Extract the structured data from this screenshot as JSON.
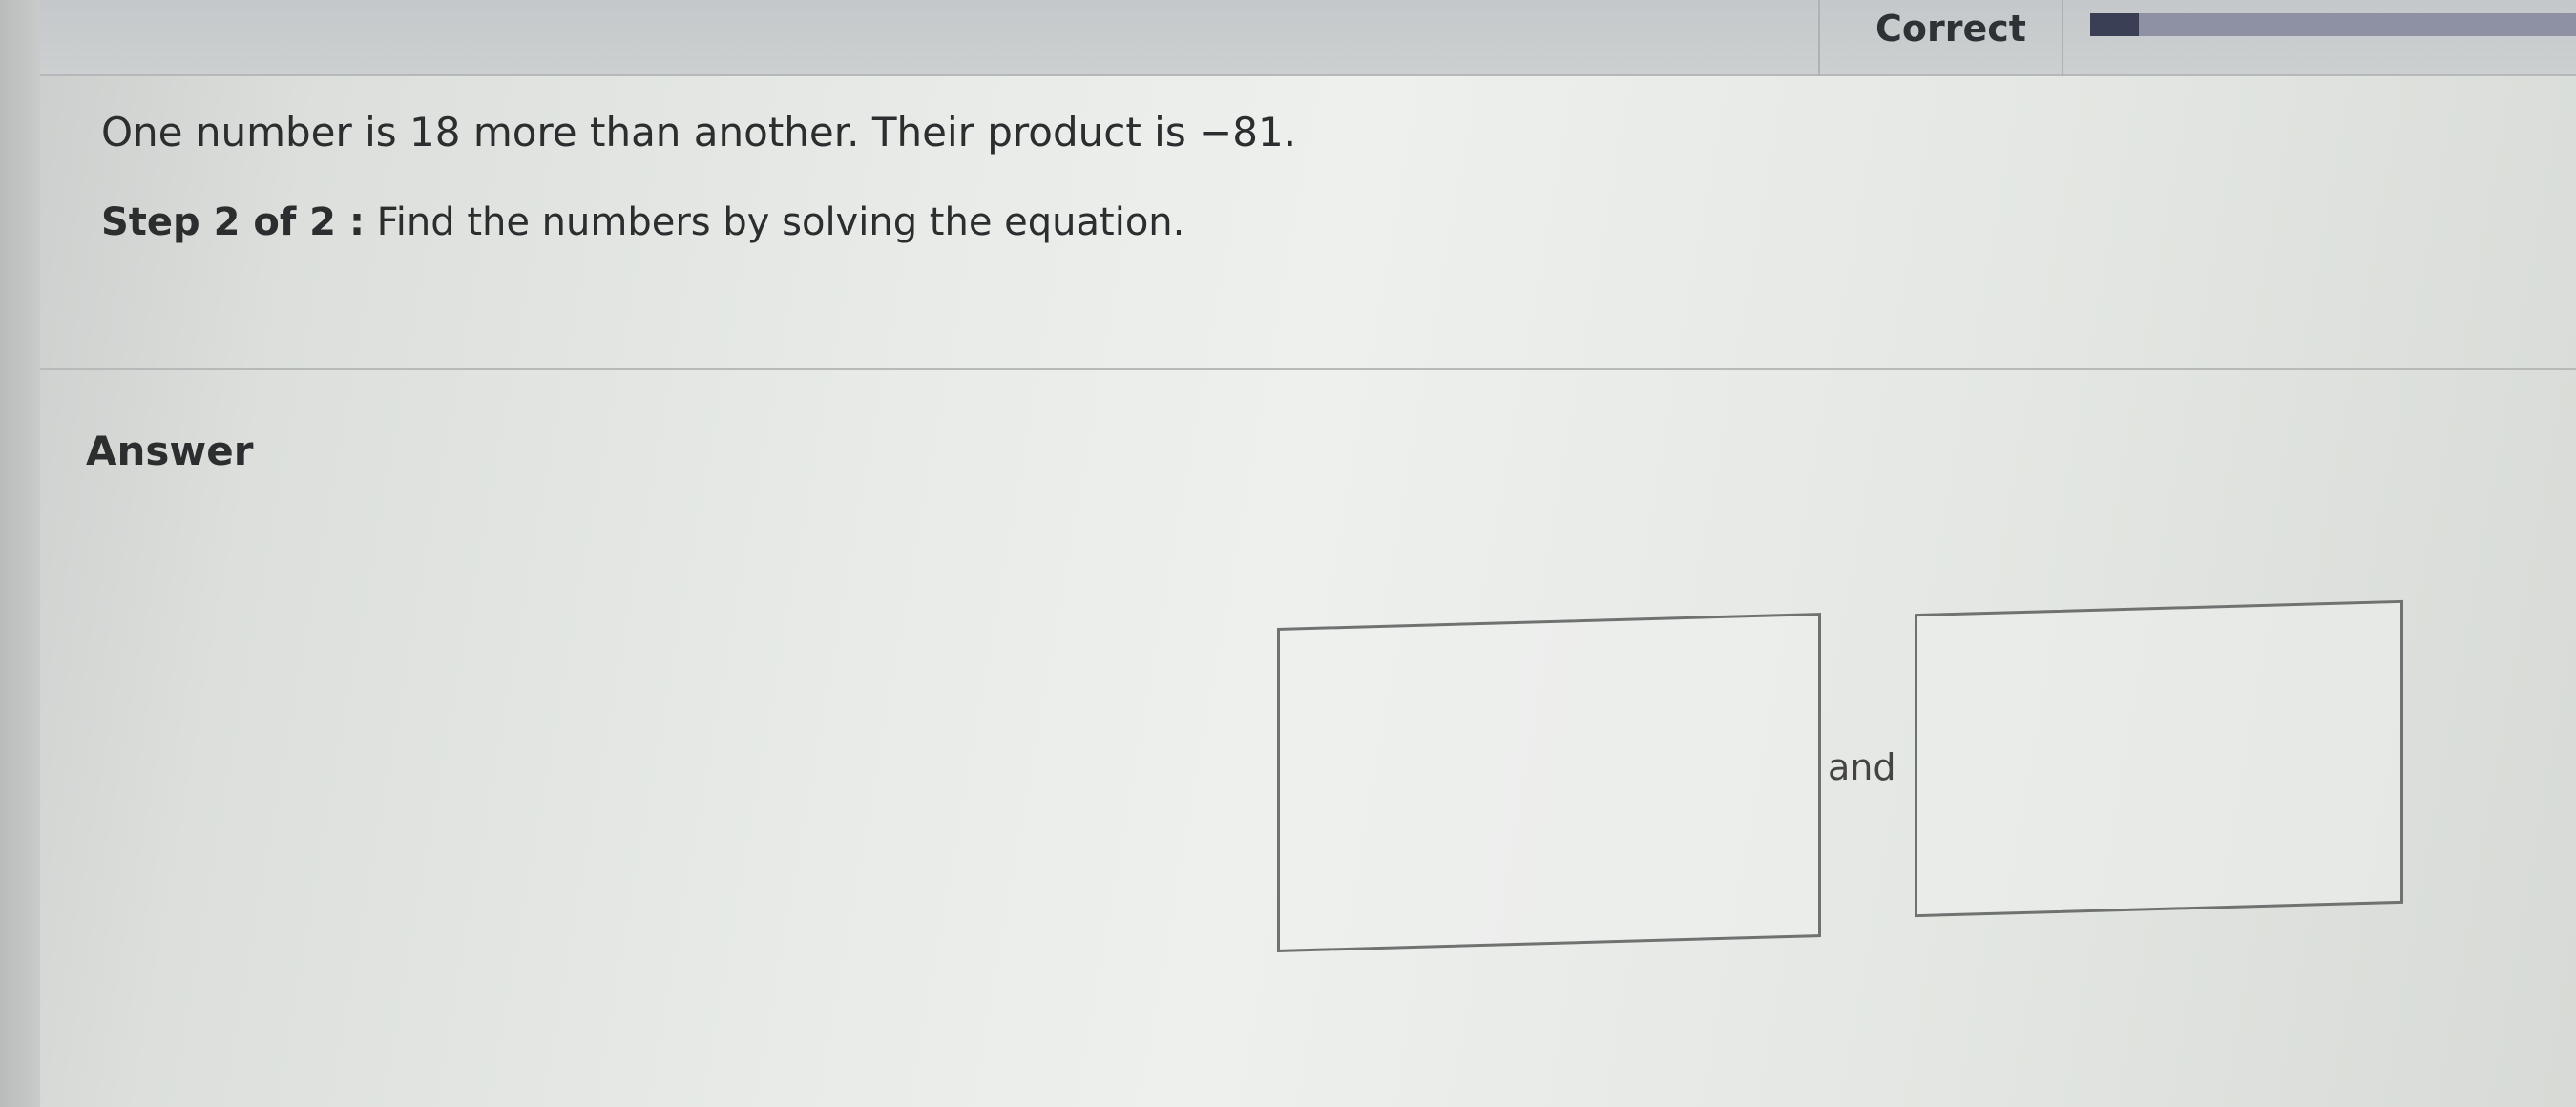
{
  "header": {
    "status_label": "Correct",
    "progress_fraction": 0.1
  },
  "question": {
    "problem_text": "One number is 18 more than another. Their product is −81.",
    "step_label": "Step 2 of 2 :",
    "step_instruction": "Find the numbers by solving the equation."
  },
  "answer": {
    "heading": "Answer",
    "first_value": "",
    "connector": "and",
    "second_value": ""
  }
}
